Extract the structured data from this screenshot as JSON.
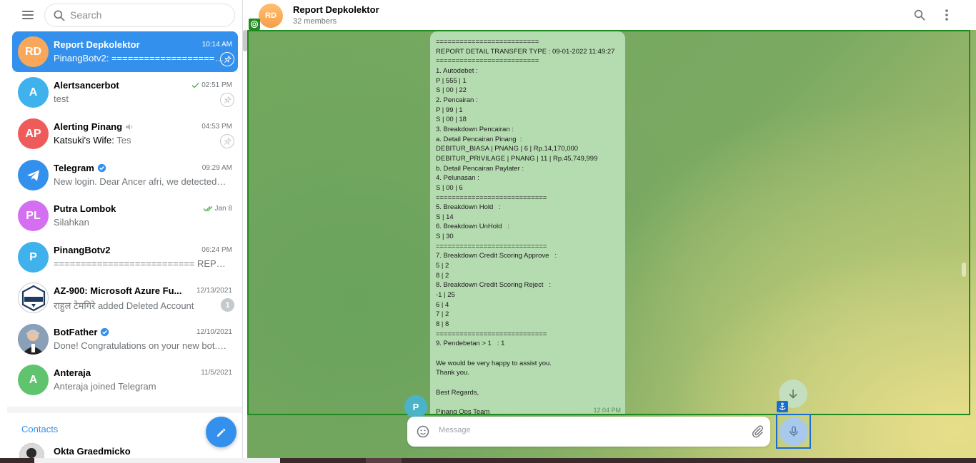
{
  "search": {
    "placeholder": "Search"
  },
  "chats": [
    {
      "initials": "RD",
      "name": "Report Depkolektor",
      "time": "10:14 AM",
      "sender": "",
      "preview": "PinangBotv2: ==========================",
      "active": true,
      "pinned": true,
      "color": "#f9a85b"
    },
    {
      "initials": "A",
      "name": "Alertsancerbot",
      "time": "02:51 PM",
      "status": "sent",
      "sender": "",
      "preview": "test",
      "pinned": true,
      "color": "#3fb1ec"
    },
    {
      "initials": "AP",
      "name": "Alerting Pinang",
      "time": "04:53 PM",
      "muted": true,
      "sender": "Katsuki's Wife: ",
      "preview": "Tes",
      "pinned": true,
      "color": "#ef5b5b"
    },
    {
      "initials": "",
      "name": "Telegram",
      "time": "09:29 AM",
      "verified": true,
      "sender": "",
      "preview": "New login. Dear Ancer afri, we detected a login into your account",
      "color": "#3390ec"
    },
    {
      "initials": "PL",
      "name": "Putra Lombok",
      "time": "Jan 8",
      "status": "read",
      "sender": "",
      "preview": "Silahkan",
      "color": "#d36ff0"
    },
    {
      "initials": "P",
      "name": "PinangBotv2",
      "time": "06:24 PM",
      "sender": "",
      "preview": "========================== REPORT DETAIL",
      "color": "#3fb1ec"
    },
    {
      "initials": "",
      "name": "AZ-900: Microsoft Azure Fu...",
      "time": "12/13/2021",
      "muted": true,
      "sender": "",
      "preview": "राहुल टेमगिरे added Deleted Account",
      "unread": "1",
      "color": "#ffffff"
    },
    {
      "initials": "",
      "name": "BotFather",
      "time": "12/10/2021",
      "verified": true,
      "sender": "",
      "preview": "Done! Congratulations on your new bot. You will find it at",
      "color": "#8aa0b8"
    },
    {
      "initials": "A",
      "name": "Anteraja",
      "time": "11/5/2021",
      "sender": "",
      "preview": "Anteraja joined Telegram",
      "color": "#5fc46d"
    }
  ],
  "contacts": {
    "title": "Contacts",
    "first_name": "Okta Graedmicko"
  },
  "header": {
    "initials": "RD",
    "title": "Report Depkolektor",
    "members": "32 members"
  },
  "message": {
    "sender_initial": "P",
    "time": "12:04 PM",
    "lines": [
      "==========================",
      "REPORT DETAIL TRANSFER TYPE : 09-01-2022 11:49:27",
      "==========================",
      "1. Autodebet :",
      "P | 555 | 1",
      "S | 00 | 22",
      "2. Pencairan :",
      "P | 99 | 1",
      "S | 00 | 18",
      "3. Breakdown Pencairan :",
      "a. Detail Pencairan Pinang  :",
      "DEBITUR_BIASA | PNANG | 6 | Rp.14,170,000",
      "DEBITUR_PRIVILAGE | PNANG | 11 | Rp.45,749,999",
      "b. Detail Pencairan Paylater :",
      "4. Pelunasan :",
      "S | 00 | 6",
      "============================",
      "5. Breakdown Hold   :",
      "S | 14",
      "6. Breakdown UnHold   :",
      "S | 30",
      "============================",
      "7. Breakdown Credit Scoring Approve   :",
      "5 | 2",
      "8 | 2",
      "8. Breakdown Credit Scoring Reject   :",
      "-1 | 25",
      "6 | 4",
      "7 | 2",
      "8 | 8",
      "============================",
      "9. Pendebetan > 1   : 1",
      "",
      "We would be very happy to assist you.",
      "Thank you.",
      "",
      "Best Regards,",
      "",
      "Pinang Ops Team"
    ]
  },
  "composer": {
    "placeholder": "Message"
  }
}
